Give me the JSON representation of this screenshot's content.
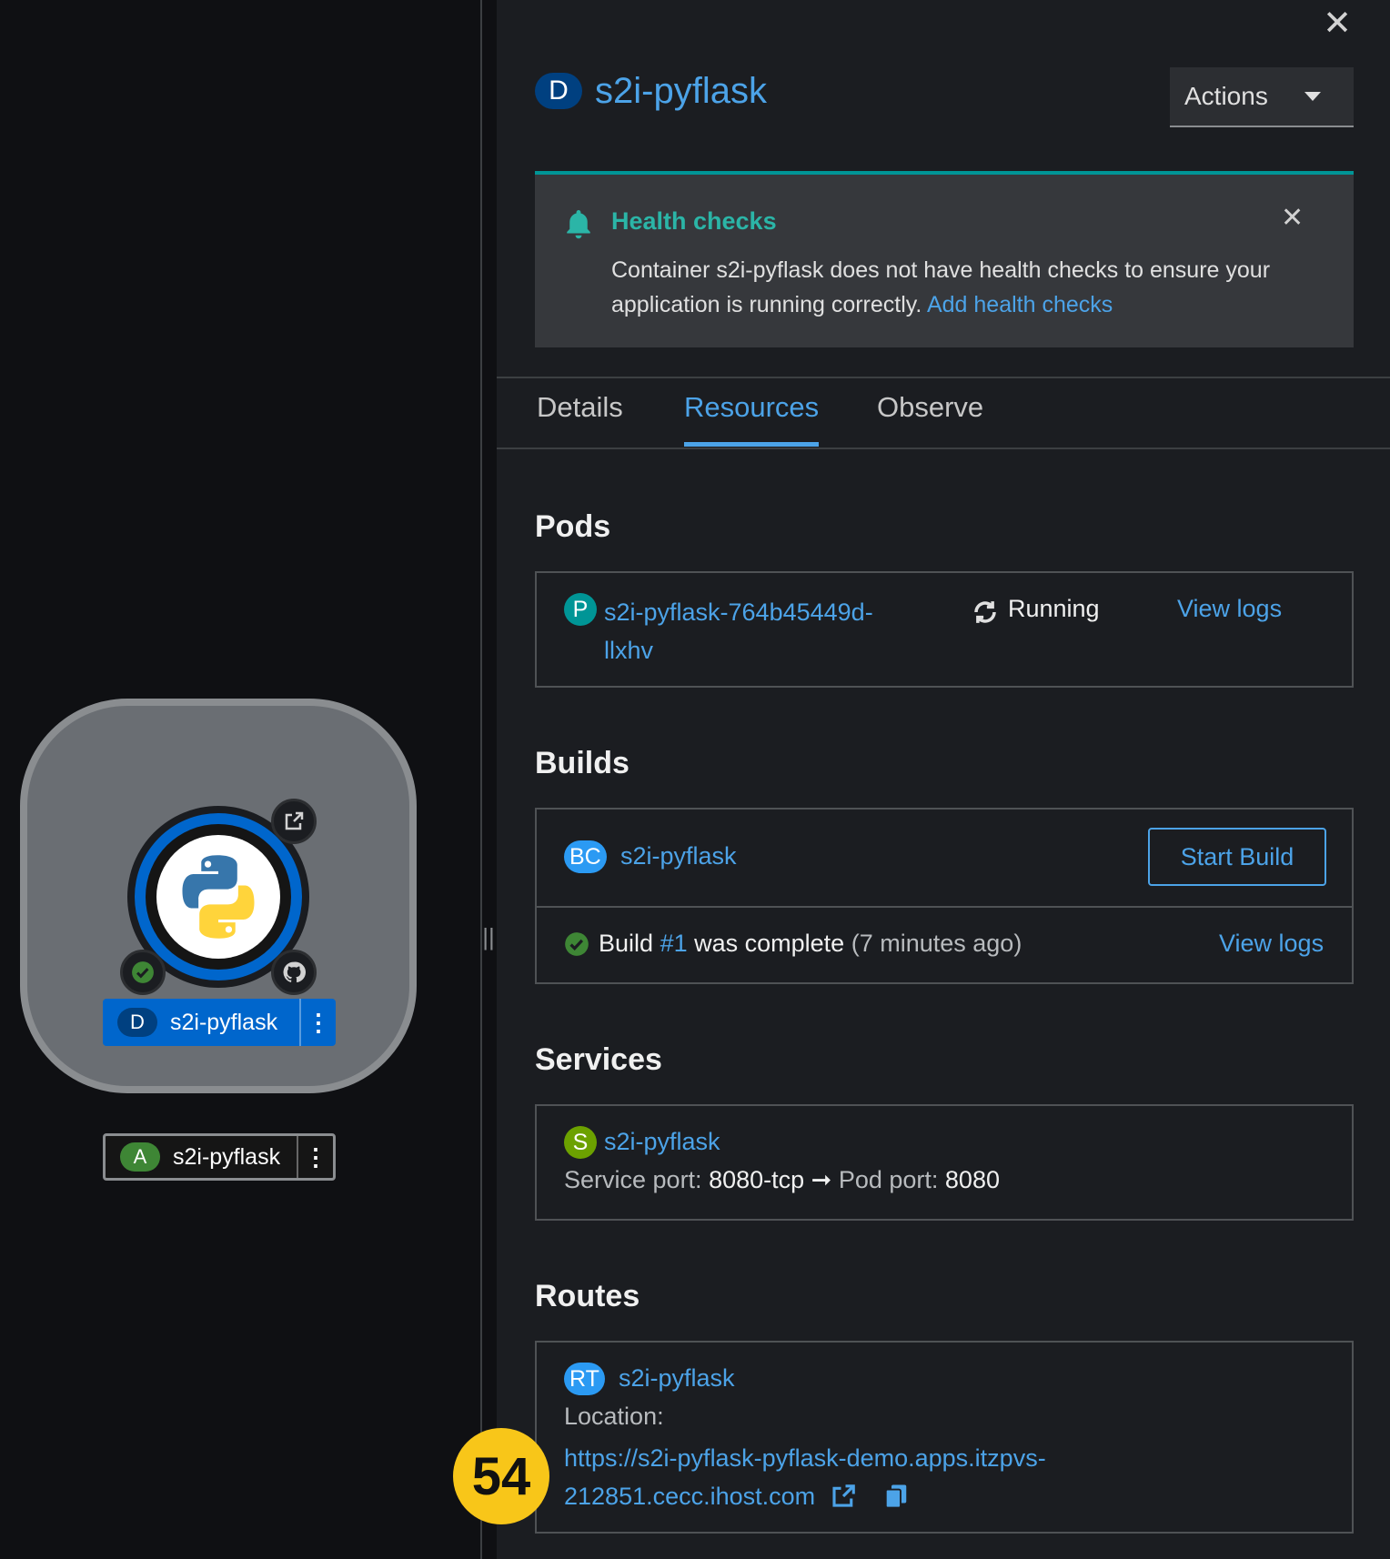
{
  "topology": {
    "deployment_label": {
      "kind": "D",
      "name": "s2i-pyflask",
      "kind_color": "#004080"
    },
    "application_label": {
      "kind": "A",
      "name": "s2i-pyflask",
      "kind_color": "#3e8635"
    },
    "decorators": [
      "external-link-icon",
      "status-check-icon",
      "github-icon"
    ],
    "node_icon": "python-logo-icon"
  },
  "panel": {
    "title_kind": "D",
    "title": "s2i-pyflask",
    "actions_label": "Actions",
    "alert": {
      "title": "Health checks",
      "body": "Container s2i-pyflask does not have health checks to ensure your application is running correctly.",
      "link": "Add health checks"
    },
    "tabs": [
      {
        "label": "Details",
        "active": false
      },
      {
        "label": "Resources",
        "active": true
      },
      {
        "label": "Observe",
        "active": false
      }
    ],
    "pods": {
      "title": "Pods",
      "items": [
        {
          "kind": "P",
          "name_line1": "s2i-pyflask-764b45449d-",
          "name_line2": "llxhv",
          "status": "Running",
          "logs": "View logs"
        }
      ]
    },
    "builds": {
      "title": "Builds",
      "config": {
        "kind": "BC",
        "name": "s2i-pyflask",
        "start_label": "Start Build"
      },
      "status": {
        "prefix": "Build",
        "number": "#1",
        "state": "was complete",
        "age": "(7 minutes ago)",
        "logs": "View logs"
      }
    },
    "services": {
      "title": "Services",
      "item": {
        "kind": "S",
        "name": "s2i-pyflask",
        "service_port_label": "Service port:",
        "service_port": "8080-tcp",
        "pod_port_label": "Pod port:",
        "pod_port": "8080"
      }
    },
    "routes": {
      "title": "Routes",
      "item": {
        "kind": "RT",
        "name": "s2i-pyflask",
        "location_label": "Location:",
        "url_line1": "https://s2i-pyflask-pyflask-demo.apps.itzpvs-",
        "url_line2": "212851.cecc.ihost.com"
      }
    }
  },
  "step_marker": "54",
  "colors": {
    "link": "#4ca3e8",
    "accent_teal": "#009596",
    "pod_badge": "#009596",
    "bc_badge": "#2b9af3",
    "service_badge": "#6ca100",
    "route_badge": "#2b9af3",
    "success": "#3e8635",
    "step_marker": "#f8c619"
  }
}
